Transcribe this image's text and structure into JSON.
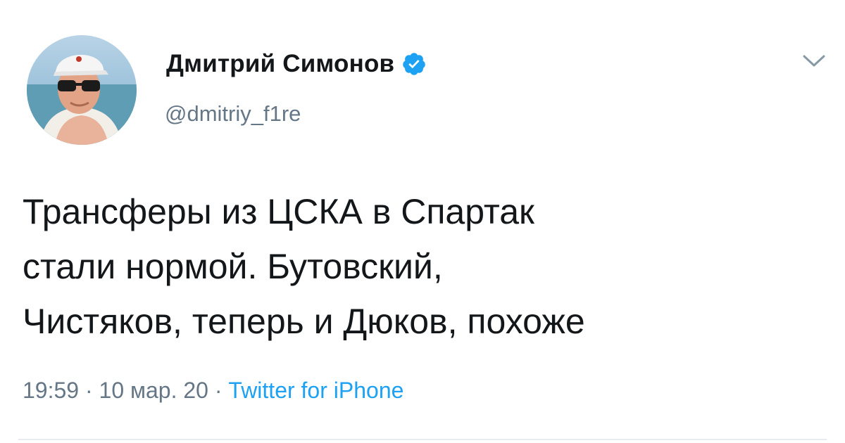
{
  "author": {
    "display_name": "Дмитрий Симонов",
    "handle": "@dmitriy_f1re",
    "verified": true
  },
  "tweet": {
    "lines": [
      "Трансферы из ЦСКА в Спартак",
      "стали нормой. Бутовский,",
      "Чистяков, теперь и Дюков, похоже"
    ]
  },
  "meta": {
    "time": "19:59",
    "separator_1": " · ",
    "date": "10 мар. 20",
    "separator_2": " · ",
    "source": "Twitter for iPhone"
  },
  "colors": {
    "verified_badge": "#1da1f2",
    "link": "#1da1f2",
    "secondary_text": "#657786"
  },
  "icons": {
    "verified": "verified-badge-icon",
    "menu": "chevron-down-icon"
  }
}
